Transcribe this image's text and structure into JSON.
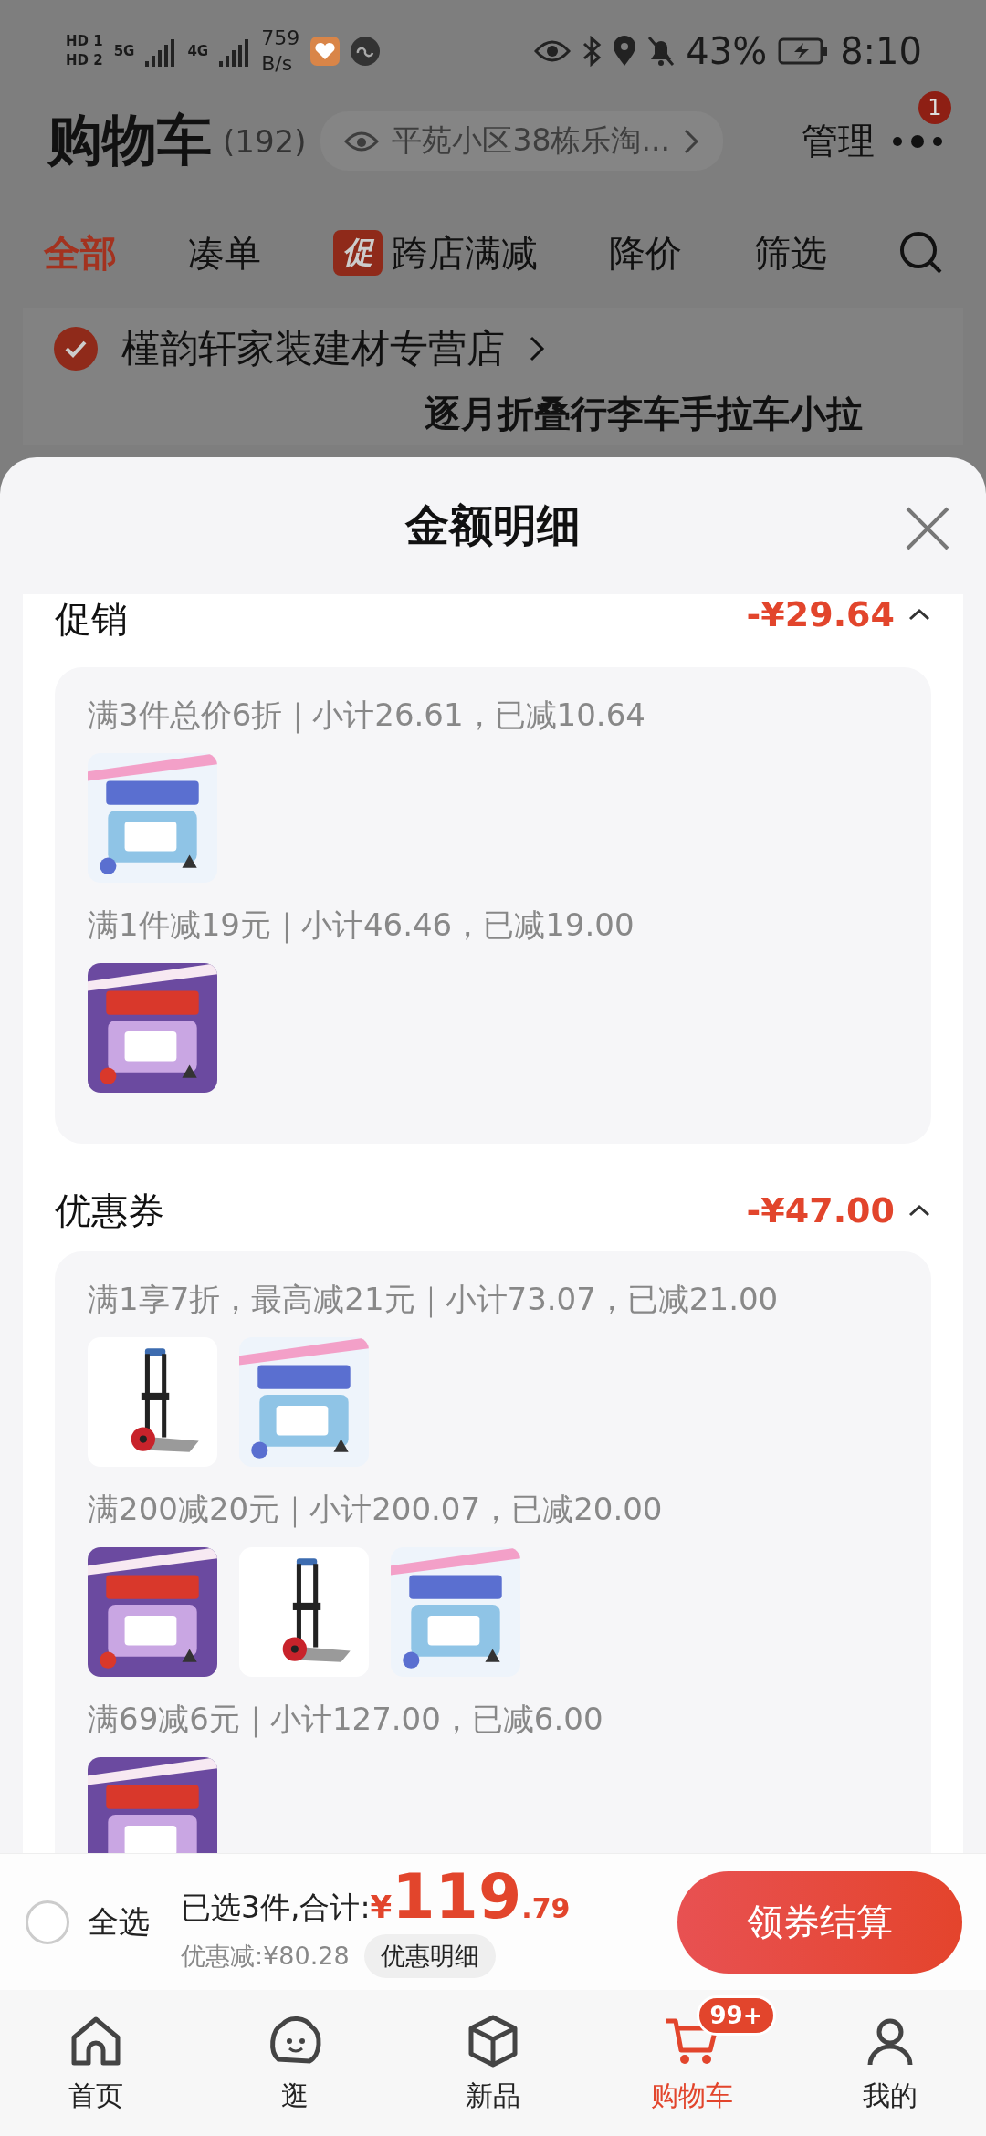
{
  "status_bar": {
    "sims": [
      {
        "label": "HD",
        "slot": "1"
      },
      {
        "label": "HD",
        "slot": "2"
      }
    ],
    "networks": [
      {
        "label": "5G"
      },
      {
        "label": "4G"
      }
    ],
    "speed": "759",
    "speed_unit": "B/s",
    "battery": "43%",
    "time": "8:10"
  },
  "header": {
    "title": "购物车",
    "count": "(192)",
    "address": "平苑小区38栋乐淘...",
    "manage": "管理",
    "more_badge": "1"
  },
  "tabs": [
    {
      "label": "全部",
      "selected": true
    },
    {
      "label": "凑单",
      "selected": false
    },
    {
      "label": "跨店满减",
      "selected": false,
      "badge": "促"
    },
    {
      "label": "降价",
      "selected": false
    },
    {
      "label": "筛选",
      "selected": false
    }
  ],
  "store": {
    "name": "槿韵轩家装建材专营店",
    "checked": true
  },
  "product": {
    "title": "逐月折叠行李车手拉车小拉"
  },
  "sheet": {
    "title": "金额明细",
    "sections": [
      {
        "title": "促销",
        "amount": "-¥29.64",
        "expanded": true,
        "groups": [
          {
            "rule": "满3件总价6折｜小计26.61，已减10.64"
          },
          {
            "rule": "满1件减19元｜小计46.46，已减19.00"
          }
        ]
      },
      {
        "title": "优惠券",
        "amount": "-¥47.00",
        "expanded": true,
        "groups": [
          {
            "rule": "满1享7折，最高减21元｜小计73.07，已减21.00"
          },
          {
            "rule": "满200减20元｜小计200.07，已减20.00"
          },
          {
            "rule": "满69减6元｜小计127.00，已减6.00"
          }
        ]
      }
    ]
  },
  "footer": {
    "select_all": {
      "label": "全选",
      "checked": false
    },
    "summary": "已选3件,合计:",
    "currency": "¥",
    "integer": "119",
    "decimal": ".79",
    "discount": "优惠减:¥80.28",
    "details_button": "优惠明细",
    "checkout": "领券结算"
  },
  "nav": [
    {
      "label": "首页",
      "selected": false
    },
    {
      "label": "逛",
      "selected": false
    },
    {
      "label": "新品",
      "selected": false
    },
    {
      "label": "购物车",
      "selected": true,
      "badge": "99+"
    },
    {
      "label": "我的",
      "selected": false
    }
  ]
}
